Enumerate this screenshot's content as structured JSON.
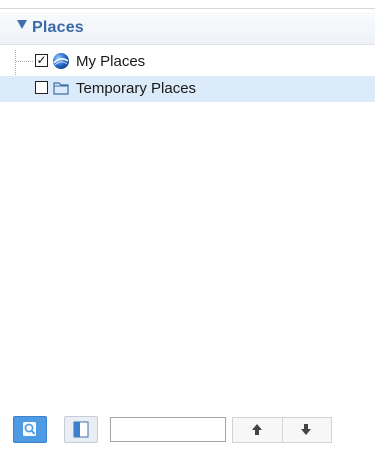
{
  "header": {
    "title": "Places"
  },
  "tree": {
    "items": [
      {
        "label": "My Places",
        "checked": true,
        "icon": "globe-icon"
      },
      {
        "label": "Temporary Places",
        "checked": false,
        "icon": "folder-icon",
        "selected": true
      }
    ]
  },
  "toolbar": {
    "search_icon": "search-icon",
    "panel_icon": "panel-toggle-icon",
    "search_value": "",
    "up_icon": "arrow-up-icon",
    "down_icon": "arrow-down-icon"
  },
  "colors": {
    "header_text": "#3a6aa8",
    "selection": "#dcebfa",
    "search_button": "#4f9be3"
  }
}
